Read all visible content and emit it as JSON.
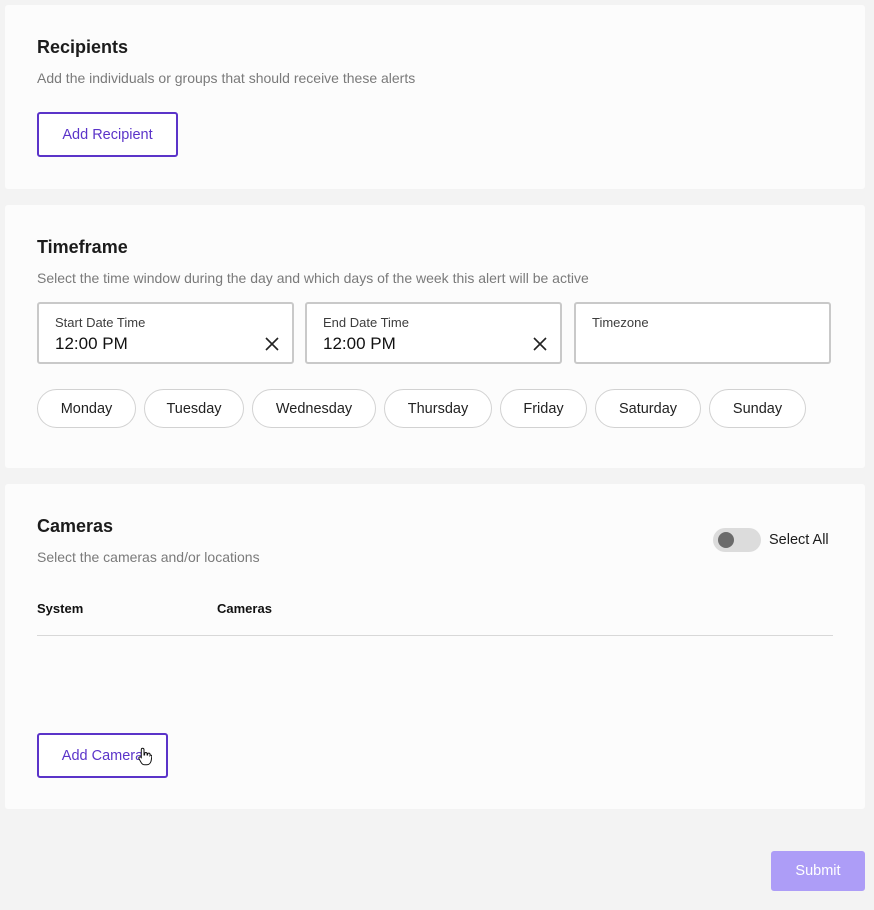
{
  "colors": {
    "accent": "#5b34c9",
    "submit_bg": "#ad9df7",
    "page_bg": "#f3f3f3"
  },
  "recipients": {
    "title": "Recipients",
    "description": "Add the individuals or groups that should receive these alerts",
    "add_label": "Add Recipient"
  },
  "timeframe": {
    "title": "Timeframe",
    "description": "Select the time window during the day and which days of the week this alert will be active",
    "start": {
      "label": "Start Date Time",
      "value": "12:00 PM",
      "icon": "close-icon"
    },
    "end": {
      "label": "End Date Time",
      "value": "12:00 PM",
      "icon": "close-icon"
    },
    "timezone": {
      "label": "Timezone",
      "value": ""
    },
    "days": [
      "Monday",
      "Tuesday",
      "Wednesday",
      "Thursday",
      "Friday",
      "Saturday",
      "Sunday"
    ]
  },
  "cameras": {
    "title": "Cameras",
    "description": "Select the cameras and/or locations",
    "select_all_label": "Select All",
    "select_all_on": false,
    "columns": [
      "System",
      "Cameras"
    ],
    "add_label": "Add Camera"
  },
  "submit_label": "Submit"
}
